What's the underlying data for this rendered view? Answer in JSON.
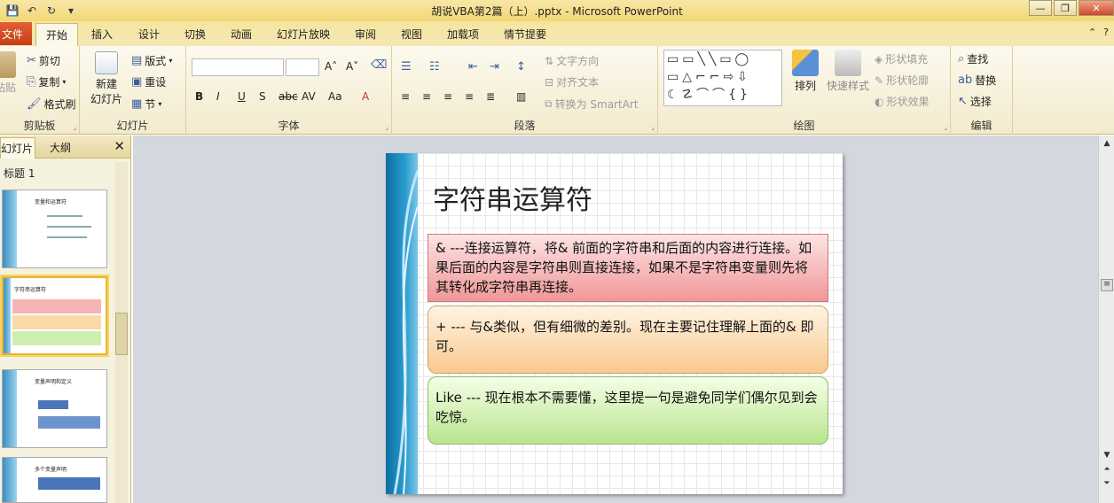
{
  "window": {
    "title": "胡说VBA第2篇（上）.pptx - Microsoft PowerPoint"
  },
  "tabs": {
    "file": "文件",
    "home": "开始",
    "insert": "插入",
    "design": "设计",
    "transitions": "切换",
    "animations": "动画",
    "slideshow": "幻灯片放映",
    "review": "审阅",
    "view": "视图",
    "addins": "加载项",
    "storyboard": "情节提要"
  },
  "ribbon": {
    "clipboard": {
      "label": "剪贴板",
      "paste": "粘贴",
      "cut": "剪切",
      "copy": "复制",
      "painter": "格式刷"
    },
    "slides": {
      "label": "幻灯片",
      "new_slide_1": "新建",
      "new_slide_2": "幻灯片",
      "layout": "版式",
      "reset": "重设",
      "section": "节"
    },
    "font": {
      "label": "字体"
    },
    "paragraph": {
      "label": "段落",
      "text_direction": "文字方向",
      "align_text": "对齐文本",
      "smartart": "转换为 SmartArt"
    },
    "drawing": {
      "label": "绘图",
      "arrange": "排列",
      "quick_styles": "快速样式",
      "shape_fill": "形状填充",
      "shape_outline": "形状轮廓",
      "shape_effects": "形状效果"
    },
    "editing": {
      "label": "编辑",
      "find": "查找",
      "replace": "替换",
      "select": "选择"
    }
  },
  "leftpane": {
    "tab_slides": "幻灯片",
    "tab_outline": "大纲",
    "outline_title": "标题 1",
    "thumbs": [
      {
        "title": "变量和运算符"
      },
      {
        "title": "字符串运算符"
      },
      {
        "title": "变量声明和定义"
      },
      {
        "title": "多个变量声明"
      }
    ]
  },
  "slide": {
    "title": "字符串运算符",
    "box1": "& ---连接运算符，将& 前面的字符串和后面的内容进行连接。如果后面的内容是字符串则直接连接，如果不是字符串变量则先将其转化成字符串再连接。",
    "box2": "+ --- 与&类似，但有细微的差别。现在主要记住理解上面的& 即可。",
    "box3": "Like --- 现在根本不需要懂，这里提一句是避免同学们偶尔见到会吃惊。"
  },
  "colors": {
    "accent": "#c43f16",
    "ribbon_bg": "#f3ebcd",
    "slide_bar": "#2a9ccf"
  }
}
